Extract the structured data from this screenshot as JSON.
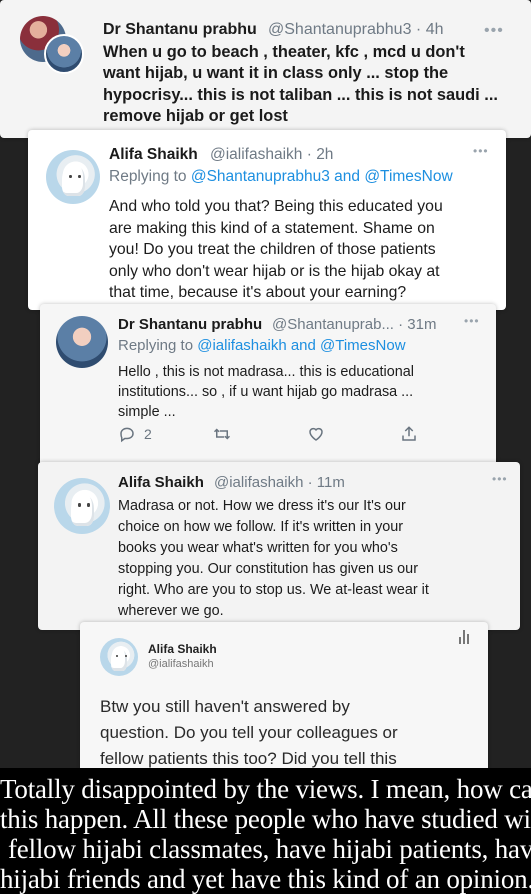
{
  "tweets": [
    {
      "name": "Dr Shantanu prabhu",
      "handle": "@Shantanuprabhu3 · 4h",
      "lines": [
        "When u go to beach , theater, kfc , mcd u don't",
        "want hijab, u want it in class only ... stop the",
        "hypocrisy... this is not taliban ... this is not saudi ...",
        "remove hijab or get lost"
      ]
    },
    {
      "name": "Alifa Shaikh",
      "handle": "@ialifashaikh · 2h",
      "reply_prefix": "Replying to ",
      "reply_mentions": "@Shantanuprabhu3 and @TimesNow",
      "lines": [
        "And who told you that? Being this educated you",
        "are making this kind of a statement. Shame on",
        "you! Do you treat the children of those patients",
        "only who don't wear hijab or is the hijab okay at",
        "that time, because it's about your earning?"
      ]
    },
    {
      "name": "Dr Shantanu prabhu",
      "handle": "@Shantanuprab... · 31m",
      "reply_prefix": "Replying to ",
      "reply_mentions": "@ialifashaikh and @TimesNow",
      "lines": [
        "Hello , this is not madrasa... this is educational",
        "institutions... so , if u want hijab go madrasa ...",
        "simple ..."
      ],
      "actions": {
        "reply_count": "2"
      }
    },
    {
      "name": "Alifa Shaikh",
      "handle": "@ialifashaikh · 11m",
      "lines": [
        "Madrasa or not. How we dress it's our It's our",
        "choice on how we follow. If it's written in your",
        "books you wear what's written for you who's",
        "stopping you. Our constitution has given us our",
        "right. Who are you to stop us. We at-least wear it",
        "wherever we go."
      ]
    },
    {
      "name": "Alifa Shaikh",
      "handle": "@ialifashaikh",
      "lines": [
        "Btw you still haven't answered by",
        "question. Do you tell your colleagues or",
        "fellow patients this too? Did you tell this"
      ]
    }
  ],
  "overlay": {
    "lines": [
      "Totally disappointed by the views. I mean, how can",
      "this happen. All these people who have studied with",
      "fellow hijabi classmates, have hijabi patients, have",
      "hijabi friends and yet have this kind of an opinion."
    ]
  },
  "icons": {
    "reply": "reply-icon",
    "retweet": "retweet-icon",
    "like": "like-icon",
    "share": "share-icon",
    "more": "more-icon",
    "analytics": "analytics-icon"
  },
  "colors": {
    "mention": "#1d8fe0",
    "text": "#1c1c1c",
    "muted": "#6f7a85",
    "overlay_bg": "#000000"
  }
}
